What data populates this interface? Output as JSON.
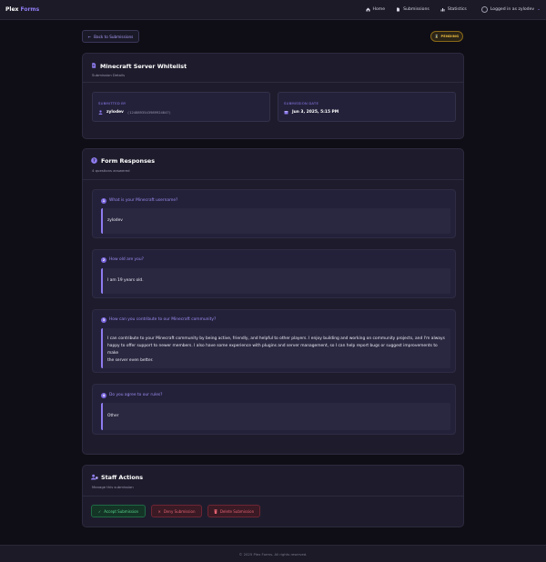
{
  "nav": {
    "brand_main": "Plex",
    "brand_accent": " Forms",
    "home_label": "Home",
    "submissions_label": "Submissions",
    "statistics_label": "Statistics",
    "user_label": "Logged in as zylodev"
  },
  "top": {
    "back_label": "Back to Submissions",
    "status_label": "PENDING"
  },
  "submission": {
    "title": "Minecraft Server Whitelist",
    "subtitle": "Submission Details",
    "submitted_by_label": "SUBMITTED BY",
    "submitted_by_name": "zylodev",
    "submitted_by_id": "(1248893543989924847)",
    "date_label": "SUBMISSION DATE",
    "date_value": "Jun 3, 2025, 5:15 PM"
  },
  "responses": {
    "title": "Form Responses",
    "subtitle": "4 questions answered",
    "items": [
      {
        "num": "1",
        "question": "What is your Minecraft username?",
        "answer": "zylodev"
      },
      {
        "num": "2",
        "question": "How old are you?",
        "answer": "I am 19 years old."
      },
      {
        "num": "3",
        "question": "How can you contribute to our Minecraft community?",
        "answer_lines": [
          "I can contribute to your Minecraft community by being active, friendly, and helpful to other players. I enjoy building and working on community projects, and I'm always",
          "happy to offer support to newer members. I also have some experience with plugins and server management, so I can help report bugs or suggest improvements to make",
          "the server even better."
        ]
      },
      {
        "num": "4",
        "question": "Do you agree to our rules?",
        "answer": "Other"
      }
    ]
  },
  "staff": {
    "title": "Staff Actions",
    "subtitle": "Manage this submission",
    "accept_label": "Accept Submission",
    "deny_label": "Deny Submission",
    "delete_label": "Delete Submission"
  },
  "footer": {
    "text": "© 2025 Plex Forms. All rights reserved."
  },
  "colors": {
    "accent": "#8f7cf0",
    "pending": "#f0c040",
    "accept": "#58d68d",
    "deny": "#e46272"
  }
}
